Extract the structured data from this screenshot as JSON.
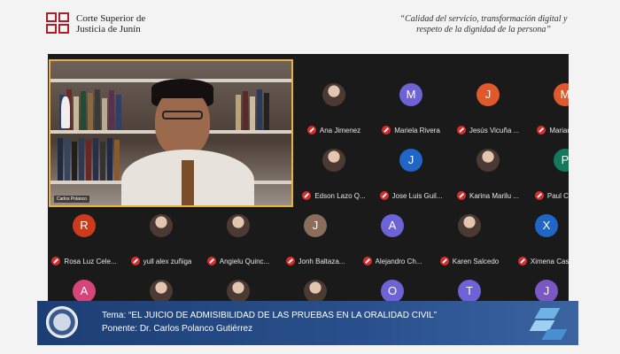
{
  "header": {
    "org_line1": "Corte Superior de",
    "org_line2": "Justicia de Junín",
    "slogan_line1": "“Calidad del servicio, transformación digital y",
    "slogan_line2": "respeto de la dignidad de la persona”"
  },
  "speaker": {
    "name_tag": "Carlos Polanco"
  },
  "colors": {
    "speaker_border": "#e8b23a",
    "mic_muted": "#d92c2c",
    "banner": "#1d3e74"
  },
  "participants": [
    {
      "name": "Ana Jimenez",
      "initial": "",
      "color": "#555555",
      "photo": true,
      "muted": true
    },
    {
      "name": "Mariela Rivera",
      "initial": "M",
      "color": "#6d63d6",
      "photo": false,
      "muted": true
    },
    {
      "name": "Jesús Vicuña ...",
      "initial": "J",
      "color": "#e0592a",
      "photo": false,
      "muted": true
    },
    {
      "name": "Marianela E...",
      "initial": "M",
      "color": "#e0592a",
      "photo": false,
      "muted": true
    },
    {
      "name": "Edson Lazo Q...",
      "initial": "",
      "color": "#555555",
      "photo": true,
      "muted": true
    },
    {
      "name": "Jose Luis Guil...",
      "initial": "J",
      "color": "#1f66c7",
      "photo": false,
      "muted": true
    },
    {
      "name": "Karina Marilu ...",
      "initial": "",
      "color": "#555555",
      "photo": true,
      "muted": true
    },
    {
      "name": "Paul Cesar R...",
      "initial": "P",
      "color": "#14795a",
      "photo": false,
      "muted": true
    },
    {
      "name": "Rosa Luz Cele...",
      "initial": "R",
      "color": "#cc3b1b",
      "photo": false,
      "muted": true
    },
    {
      "name": "yull alex zuñiga",
      "initial": "",
      "color": "#555555",
      "photo": true,
      "muted": true
    },
    {
      "name": "Angielu Quinc...",
      "initial": "",
      "color": "#555555",
      "photo": true,
      "muted": true
    },
    {
      "name": "Jonh Baltaza...",
      "initial": "J",
      "color": "#8a6d5a",
      "photo": false,
      "muted": true
    },
    {
      "name": "Alejandro Ch...",
      "initial": "A",
      "color": "#6d63d6",
      "photo": false,
      "muted": true
    },
    {
      "name": "Karen Salcedo",
      "initial": "",
      "color": "#555555",
      "photo": true,
      "muted": true
    },
    {
      "name": "Ximena Cas...",
      "initial": "X",
      "color": "#1f66c7",
      "photo": false,
      "muted": true
    },
    {
      "name": "",
      "initial": "A",
      "color": "#d6457a",
      "photo": false,
      "muted": false
    },
    {
      "name": "",
      "initial": "",
      "color": "#555555",
      "photo": true,
      "muted": false
    },
    {
      "name": "",
      "initial": "",
      "color": "#555555",
      "photo": true,
      "muted": false
    },
    {
      "name": "",
      "initial": "",
      "color": "#555555",
      "photo": true,
      "muted": false
    },
    {
      "name": "",
      "initial": "O",
      "color": "#6d63d6",
      "photo": false,
      "muted": false
    },
    {
      "name": "",
      "initial": "T",
      "color": "#6d63d6",
      "photo": false,
      "muted": false
    },
    {
      "name": "",
      "initial": "J",
      "color": "#7a58c4",
      "photo": false,
      "muted": false
    }
  ],
  "banner": {
    "topic": "Tema: “EL JUICIO DE ADMISIBILIDAD DE LAS PRUEBAS EN LA ORALIDAD CIVIL”",
    "speaker": "Ponente: Dr. Carlos Polanco Gutiérrez"
  }
}
